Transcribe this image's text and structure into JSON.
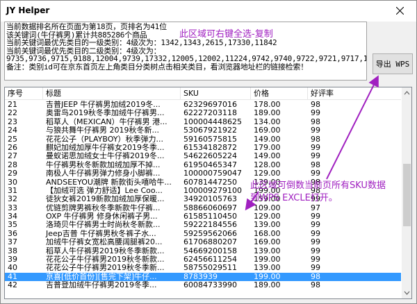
{
  "window": {
    "title": "JY Helper"
  },
  "info": {
    "lines": [
      "当前数据排名所在页面为第18页，页排名为41位",
      "该关键词(牛仔裤男)累计共885286个商品",
      "当前关键词最优先类目的一级类别：4级次为：1342,1343,2615,17330,11842",
      "当前关键词最优先类目的二级类别：4级次为：",
      "9735,9736,9715,9188,12004,9739,17332,12005,12002,11224,9742,9740,9722,9721,9717,1350",
      "备注：类别id可在京东首页左上角类目分类树点击相关类目，看浏览器地址栏的链接检索！"
    ]
  },
  "export_button": {
    "label": "导出 WPS"
  },
  "table": {
    "headers": [
      "序号",
      "标题",
      "SKU",
      "价格",
      "好评率"
    ],
    "rows": [
      [
        "21",
        "吉普JEEP 牛仔裤男加绒2019冬...",
        "62329697016",
        "178.00",
        "98"
      ],
      [
        "22",
        "奥雷鸟2019秋冬季加绒牛仔裤男...",
        "62227203118",
        "189.00",
        "99"
      ],
      [
        "23",
        "稻草人（MEXICAN）牛仔裤男 港...",
        "100004448625",
        "134.00",
        "98"
      ],
      [
        "24",
        "与狼共舞牛仔裤男 2019秋冬新...",
        "53067921922",
        "169.00",
        "99"
      ],
      [
        "25",
        "花花公子（PLAYBOY）秋季弹力...",
        "59160575815",
        "149.00",
        "98"
      ],
      [
        "26",
        "麒妃加绒加厚牛仔裤女2019冬季...",
        "61534182872",
        "179.00",
        "99"
      ],
      [
        "27",
        "曼蚁诺思加绒女士牛仔裤2019冬...",
        "54622605224",
        "149.00",
        "99"
      ],
      [
        "28",
        "牛仔裤男秋冬新款加绒加厚不掉...",
        "61950465347",
        "128.00",
        "98"
      ],
      [
        "29",
        "南极人牛仔裤男弹力修身小脚裤...",
        "100000759047",
        "129.00",
        "99"
      ],
      [
        "30",
        "ANDSEEYOU潮牌 新款街头嘻哈牛...",
        "60781447250",
        "139.00",
        "98"
      ],
      [
        "31",
        "【加绒可选 弹力舒适】Lee Coo...",
        "100009279100",
        "199.00",
        "98"
      ],
      [
        "32",
        "徒狄女裤2019新款加绒加厚保暖...",
        "34920105763",
        "159.00",
        "99"
      ],
      [
        "33",
        "优链剪牌男裤秋冬季新款牛仔裤...",
        "58866060697",
        "109.00",
        "97"
      ],
      [
        "34",
        "OXP 牛仔裤男 修身休闲裤子男...",
        "61585110450",
        "129.00",
        "99"
      ],
      [
        "35",
        "洛琦贝牛仔裤男士时尚秋冬新款...",
        "59222184556",
        "139.00",
        "99"
      ],
      [
        "36",
        "Jeep吉普 牛仔裤男秋冬裤子水...",
        "59259562066",
        "168.00",
        "99"
      ],
      [
        "37",
        "加绒牛仔裤女宽松高腰阔腿裤20...",
        "61706880207",
        "169.00",
        "99"
      ],
      [
        "38",
        "稻草人牛仔裤男2019秋冬季新款...",
        "54669200158",
        "139.00",
        "99"
      ],
      [
        "39",
        "花花公子牛仔裤男2019秋冬新款...",
        "62456611254",
        "199.00",
        "99"
      ],
      [
        "40",
        "花花公子牛仔裤男2019秋冬季新...",
        "58755029511",
        "139.00",
        "99"
      ],
      [
        "41",
        "京喜[低价首份][售完下架]牛仔...",
        "8783939",
        "199.00",
        "98"
      ],
      [
        "42",
        "吉普登加绒牛仔裤男2019冬季...",
        "60084733990",
        "189.00",
        "98"
      ]
    ],
    "selected_index": 20
  },
  "annotations": {
    "top": "此区域可右键全选-复制",
    "mid_line1": "此区域可倒数当前页所有SKU数据",
    "mid_line2": "到WPS EXCLE打开。"
  },
  "colors": {
    "annotation": "#a020c0",
    "selection": "#3399ff"
  }
}
